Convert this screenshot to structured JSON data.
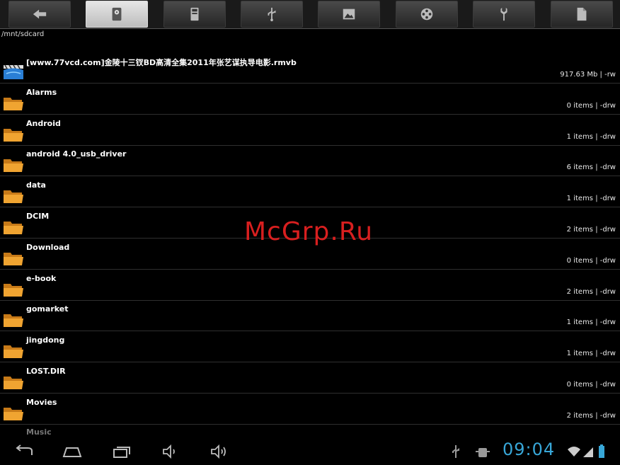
{
  "toolbar": {
    "tabs": [
      {
        "icon": "back-arrow-icon"
      },
      {
        "icon": "sdcard-icon",
        "active": true
      },
      {
        "icon": "storage-icon"
      },
      {
        "icon": "usb-icon"
      },
      {
        "icon": "image-icon"
      },
      {
        "icon": "film-reel-icon"
      },
      {
        "icon": "wrench-icon"
      },
      {
        "icon": "document-icon"
      }
    ]
  },
  "current_path": "/mnt/sdcard",
  "files": [
    {
      "name": "[www.77vcd.com]金陵十三钗BD高清全集2011年张艺谋执导电影.rmvb",
      "meta": "917.63 Mb  | -rw",
      "icon": "video-file-icon"
    },
    {
      "name": "Alarms",
      "meta": "0 items | -drw",
      "icon": "folder-icon"
    },
    {
      "name": "Android",
      "meta": "1 items | -drw",
      "icon": "folder-icon"
    },
    {
      "name": "android 4.0_usb_driver",
      "meta": "6 items | -drw",
      "icon": "folder-icon"
    },
    {
      "name": "data",
      "meta": "1 items | -drw",
      "icon": "folder-icon"
    },
    {
      "name": "DCIM",
      "meta": "2 items | -drw",
      "icon": "folder-icon"
    },
    {
      "name": "Download",
      "meta": "0 items | -drw",
      "icon": "folder-icon"
    },
    {
      "name": "e-book",
      "meta": "2 items | -drw",
      "icon": "folder-icon"
    },
    {
      "name": "gomarket",
      "meta": "1 items | -drw",
      "icon": "folder-icon"
    },
    {
      "name": "jingdong",
      "meta": "1 items | -drw",
      "icon": "folder-icon"
    },
    {
      "name": "LOST.DIR",
      "meta": "0 items | -drw",
      "icon": "folder-icon"
    },
    {
      "name": "Movies",
      "meta": "2 items | -drw",
      "icon": "folder-icon"
    }
  ],
  "partial_row": "Music",
  "watermark": "McGrp.Ru",
  "status": {
    "time": "09:04",
    "accent": "#38a7d8"
  }
}
